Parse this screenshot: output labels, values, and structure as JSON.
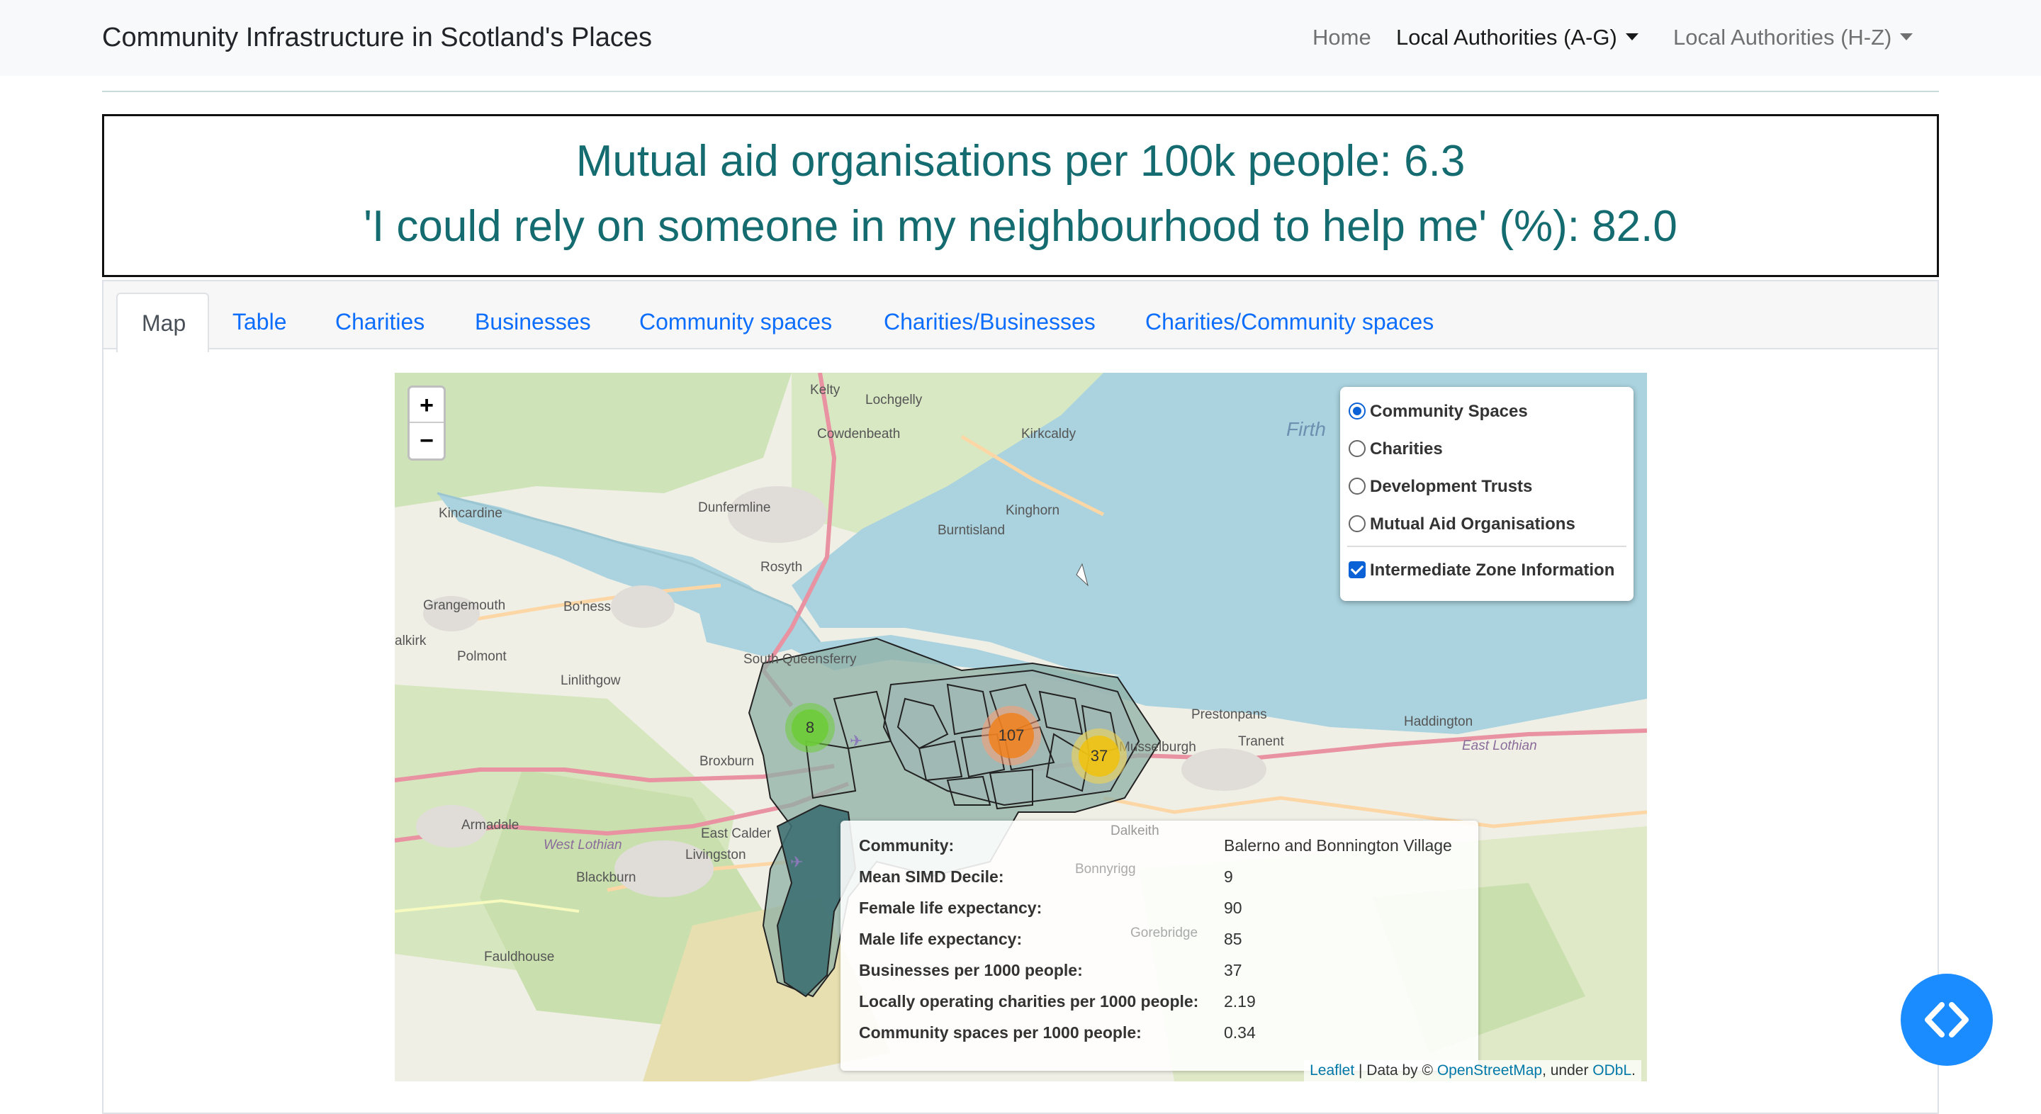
{
  "navbar": {
    "brand": "Community Infrastructure in Scotland's Places",
    "links": [
      {
        "label": "Home",
        "active": false,
        "dropdown": false
      },
      {
        "label": "Local Authorities (A-G)",
        "active": true,
        "dropdown": true
      },
      {
        "label": "Local Authorities (H-Z)",
        "active": false,
        "dropdown": true
      }
    ]
  },
  "headline": {
    "line1": "Mutual aid organisations per 100k people: 6.3",
    "line2": "'I could rely on someone in my neighbourhood to help me' (%): 82.0",
    "color": "#146c70"
  },
  "tabs": [
    "Map",
    "Table",
    "Charities",
    "Businesses",
    "Community spaces",
    "Charities/Businesses",
    "Charities/Community spaces"
  ],
  "active_tab": "Map",
  "map": {
    "zoom_in": "+",
    "zoom_out": "−",
    "layers": {
      "base": [
        {
          "label": "Community Spaces",
          "checked": true
        },
        {
          "label": "Charities",
          "checked": false
        },
        {
          "label": "Development Trusts",
          "checked": false
        },
        {
          "label": "Mutual Aid Organisations",
          "checked": false
        }
      ],
      "overlay": {
        "label": "Intermediate Zone Information",
        "checked": true
      }
    },
    "clusters": [
      {
        "count": "8",
        "color": "#6ecc39"
      },
      {
        "count": "107",
        "color": "#fd9c73"
      },
      {
        "count": "37",
        "color": "#f1d357"
      }
    ],
    "places": [
      "Kelty",
      "Lochgelly",
      "Cowdenbeath",
      "Kirkcaldy",
      "Kincardine",
      "Dunfermline",
      "Kinghorn",
      "Burntisland",
      "Rosyth",
      "Grangemouth",
      "Bo'ness",
      "alkirk",
      "Polmont",
      "Linlithgow",
      "South Queensferry",
      "Broxburn",
      "Prestonpans",
      "Haddington",
      "Tranent",
      "Musselburgh",
      "East Lothian",
      "Armadale",
      "West Lothian",
      "East Calder",
      "Livingston",
      "Blackburn",
      "Fauldhouse",
      "Dalkeith",
      "Bonnyrigg",
      "Gorebridge",
      "Firth"
    ],
    "info": {
      "rows": [
        {
          "key": "Community:",
          "value": "Balerno and Bonnington Village"
        },
        {
          "key": "Mean SIMD Decile:",
          "value": "9"
        },
        {
          "key": "Female life expectancy:",
          "value": "90"
        },
        {
          "key": "Male life expectancy:",
          "value": "85"
        },
        {
          "key": "Businesses per 1000 people:",
          "value": "37"
        },
        {
          "key": "Locally operating charities per 1000 people:",
          "value": "2.19"
        },
        {
          "key": "Community spaces per 1000 people:",
          "value": "0.34"
        }
      ]
    },
    "attribution": {
      "leaflet": "Leaflet",
      "sep": " | Data by © ",
      "osm": "OpenStreetMap",
      "under": ", under ",
      "license": "ODbL",
      "end": "."
    }
  },
  "fab_icon": "code-icon"
}
